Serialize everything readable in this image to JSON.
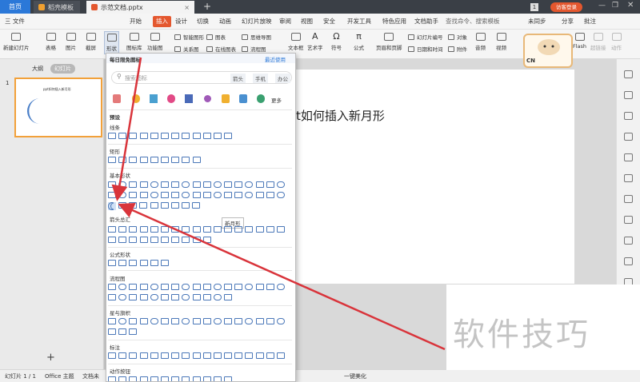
{
  "titlebar": {
    "home_tab": "首页",
    "tabs": [
      {
        "label": "稻壳模板"
      },
      {
        "label": "示范文档.pptx"
      }
    ],
    "page_counter": "1",
    "login_button": "访客登录"
  },
  "menubar": {
    "file": "三 文件",
    "items": [
      "开始",
      "插入",
      "设计",
      "切换",
      "动画",
      "幻灯片放映",
      "审阅",
      "视图",
      "安全",
      "开发工具",
      "特色应用",
      "文档助手"
    ],
    "active_item": "插入",
    "search_placeholder": "查找命令、搜索模板",
    "sync_status": "未同步",
    "share": "分享",
    "comment": "批注"
  },
  "ribbon": {
    "new_slide": "新建幻灯片",
    "table": "表格",
    "picture": "图片",
    "screenshot": "截屏",
    "shapes": "形状",
    "icon_library": "图标库",
    "function_chart": "功能图",
    "smart_art": "智能图形",
    "chart": "图表",
    "mind_map": "思维导图",
    "relation": "关系图",
    "online_chart": "在线图表",
    "flowchart": "流程图",
    "text_box": "文本框",
    "art_text": "艺术字",
    "symbol": "符号",
    "formula": "公式",
    "header_footer": "页眉和页脚",
    "slide_number": "幻灯片编号",
    "object": "对象",
    "date_time": "日期和时间",
    "attachment": "附件",
    "audio": "音频",
    "video": "视频",
    "flash": "Flash",
    "hyperlink": "超链接",
    "action": "动作"
  },
  "leftpane": {
    "tab_outline": "大纲",
    "tab_slides": "幻灯片",
    "slide_number": "1",
    "thumb_title": "ppt如何插入新月形",
    "add_button": "+"
  },
  "slide": {
    "title": "ppt如何插入新月形",
    "title_visible_part": "t如何插入新月形"
  },
  "dropdown": {
    "header": "每日限免图标",
    "more_used": "最近使用",
    "search_placeholder": "搜索图标",
    "search_tags": [
      "箭头",
      "手机",
      "办公"
    ],
    "more": "更多",
    "preset": "预设",
    "sections": [
      "线条",
      "矩形",
      "基本形状",
      "箭头总汇",
      "公式形状",
      "流程图",
      "星与旗帜",
      "标注",
      "动作按钮"
    ],
    "tooltip": "新月形"
  },
  "status": {
    "slide_info": "幻灯片 1 / 1",
    "theme": "Office 主题",
    "doc_state": "文档未",
    "beautify": "一键美化"
  },
  "mascot": {
    "badge": "CN"
  },
  "watermark": "软件技巧",
  "colors": {
    "accent": "#e4572e",
    "arrow": "#d9343b",
    "shape_stroke": "#4a77b8",
    "home_tab": "#2b78d8",
    "thumb_border": "#f2a13a",
    "moon": "#4a7fc8"
  }
}
